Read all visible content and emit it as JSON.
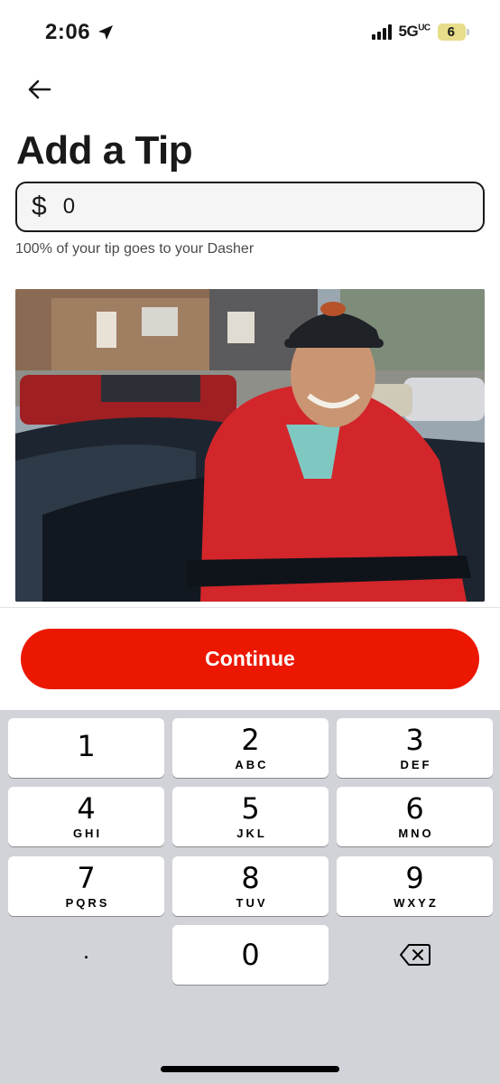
{
  "status": {
    "time": "2:06",
    "network": "5G",
    "network_sup": "UC",
    "battery": "6"
  },
  "header": {
    "title": "Add a Tip",
    "back_icon": "arrow-left-icon"
  },
  "tip": {
    "currency": "$",
    "value": "0",
    "helper": "100% of your tip goes to your Dasher"
  },
  "actions": {
    "continue_label": "Continue"
  },
  "colors": {
    "accent": "#eb1700",
    "keypad_bg": "#d1d3d9"
  },
  "keypad": {
    "rows": [
      [
        {
          "num": "1",
          "letters": ""
        },
        {
          "num": "2",
          "letters": "ABC"
        },
        {
          "num": "3",
          "letters": "DEF"
        }
      ],
      [
        {
          "num": "4",
          "letters": "GHI"
        },
        {
          "num": "5",
          "letters": "JKL"
        },
        {
          "num": "6",
          "letters": "MNO"
        }
      ],
      [
        {
          "num": "7",
          "letters": "PQRS"
        },
        {
          "num": "8",
          "letters": "TUV"
        },
        {
          "num": "9",
          "letters": "WXYZ"
        }
      ]
    ],
    "decimal": ".",
    "zero": "0",
    "delete_icon": "backspace-icon"
  }
}
